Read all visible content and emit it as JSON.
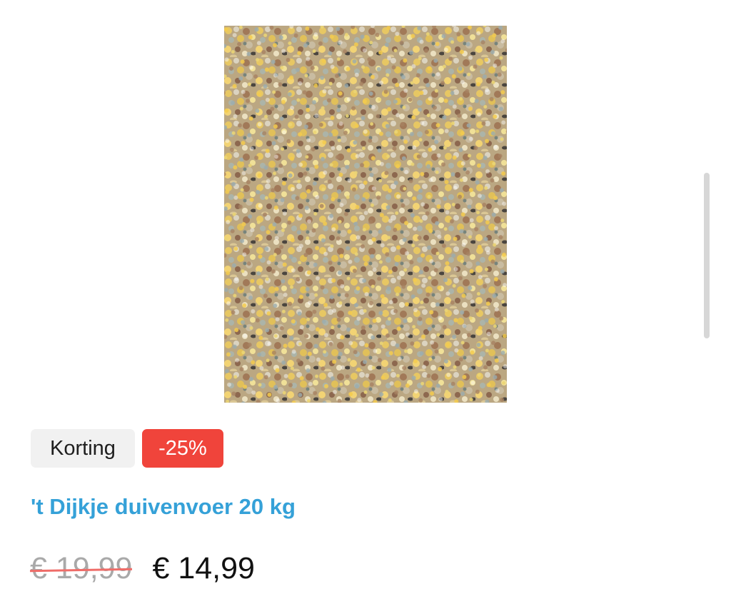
{
  "product": {
    "image_alt": "Duivenvoer korrels",
    "badges": {
      "korting": "Korting",
      "discount": "-25%"
    },
    "title": "'t Dijkje duivenvoer 20 kg",
    "old_price": "€ 19,99",
    "new_price": "€ 14,99"
  },
  "colors": {
    "title": "#35a1d8",
    "discount_badge": "#f0443b",
    "korting_badge": "#f1f1f1"
  }
}
